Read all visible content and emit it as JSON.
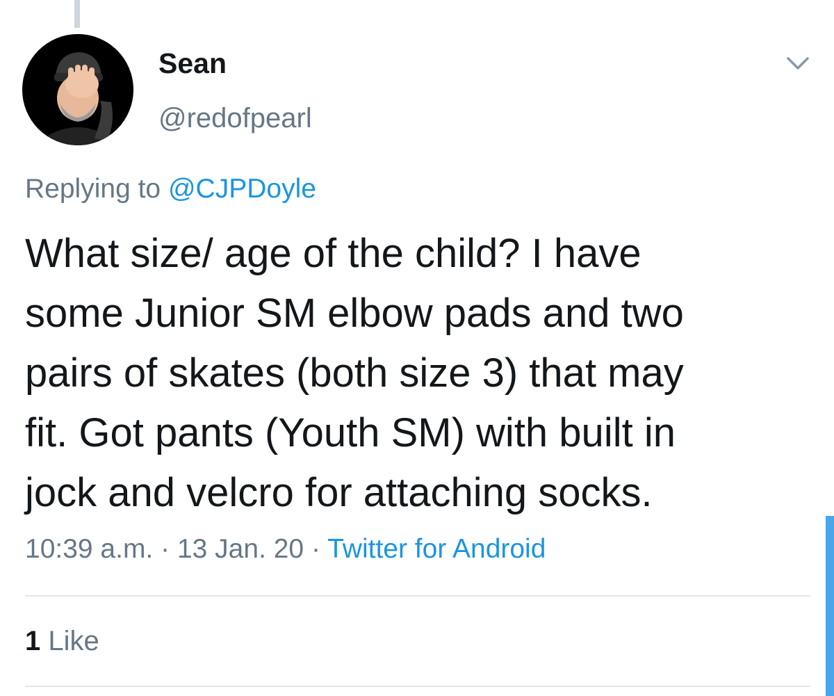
{
  "tweet": {
    "author": {
      "display_name": "Sean",
      "handle": "@redofpearl",
      "avatar_icon": "facepalm-avatar"
    },
    "menu_icon": "chevron-down-icon",
    "replying_to_label": "Replying to",
    "replying_to_handle": "@CJPDoyle",
    "body_lines": [
      "What size/ age of the child? I have",
      "some Junior SM elbow pads and two",
      "pairs of skates (both size 3) that may",
      "fit. Got pants (Youth SM) with built in",
      "jock and velcro for attaching socks."
    ],
    "time": "10:39 a.m.",
    "date": "13 Jan. 20",
    "separator": "·",
    "source": "Twitter for Android",
    "likes_count": "1",
    "likes_label": "Like"
  },
  "colors": {
    "text": "#14171a",
    "secondary": "#657786",
    "link": "#1b95e0",
    "divider": "#e1e8ed",
    "thread_line": "#ccd6dd",
    "scrollbar": "#49a6e9"
  }
}
